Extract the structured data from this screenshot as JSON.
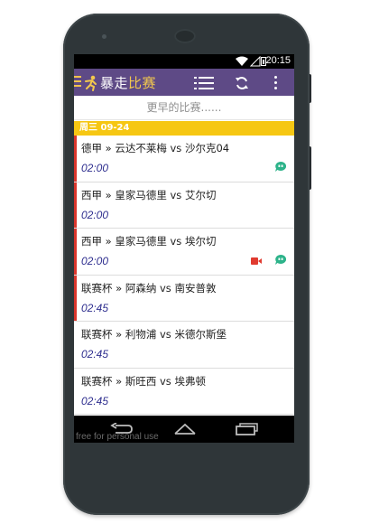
{
  "status_bar": {
    "time": "20:15"
  },
  "app_bar": {
    "title_part1": "暴走",
    "title_part2": "比赛",
    "accent_color": "#5e4a86",
    "title_color": "#f2c84e"
  },
  "earlier_label": "更早的比赛......",
  "date_header": "周三 09-24",
  "matches": [
    {
      "teams": "德甲 » 云达不莱梅 vs 沙尔克04",
      "time": "02:00",
      "live": true,
      "chat": true,
      "video": false
    },
    {
      "teams": "西甲 » 皇家马德里 vs 艾尔切",
      "time": "02:00",
      "live": true,
      "chat": false,
      "video": false
    },
    {
      "teams": "西甲 » 皇家马德里 vs 埃尔切",
      "time": "02:00",
      "live": true,
      "chat": true,
      "video": true
    },
    {
      "teams": "联赛杯 » 阿森纳 vs 南安普敦",
      "time": "02:45",
      "live": true,
      "chat": false,
      "video": false
    },
    {
      "teams": "联赛杯 » 利物浦 vs 米德尔斯堡",
      "time": "02:45",
      "live": false,
      "chat": false,
      "video": false
    },
    {
      "teams": "联赛杯 » 斯旺西 vs 埃弗顿",
      "time": "02:45",
      "live": false,
      "chat": false,
      "video": false
    }
  ],
  "watermark": "free for personal use"
}
